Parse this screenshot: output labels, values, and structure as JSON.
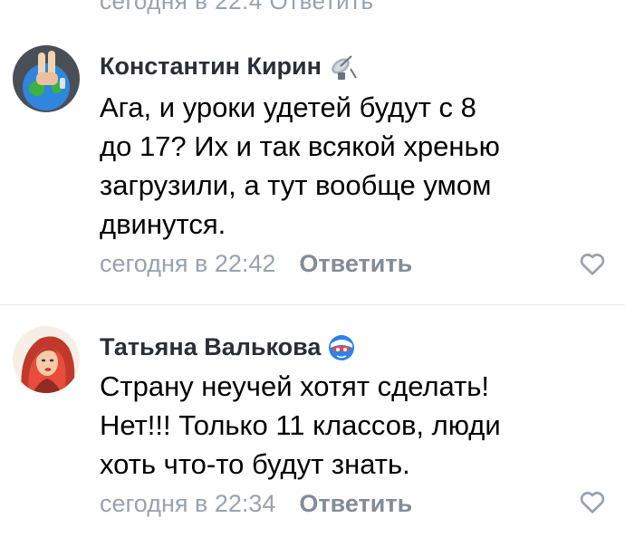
{
  "top_partial_text": "сегодня в 22:4  Ответить",
  "comments": [
    {
      "author": "Константин Кирин",
      "badge_icon": "satellite-dish-icon",
      "lines": [
        "Ага, и уроки удетей будут с 8",
        "до 17? Их и так всякой хренью",
        "загрузили, а тут вообще умом",
        "двинутся."
      ],
      "time": "сегодня в 22:42",
      "reply_label": "Ответить",
      "like_icon": "heart-outline-icon"
    },
    {
      "author": "Татьяна Валькова",
      "badge_icon": "superhero-mask-icon",
      "lines": [
        "Страну неучей хотят сделать!",
        "Нет!!! Только 11 классов, люди",
        "хоть что-то будут знать."
      ],
      "time": "сегодня в 22:34",
      "reply_label": "Ответить",
      "like_icon": "heart-outline-icon"
    }
  ],
  "colors": {
    "author": "#2a2f36",
    "meta": "#99a2ad",
    "reply": "#818c99",
    "text": "#000000"
  }
}
